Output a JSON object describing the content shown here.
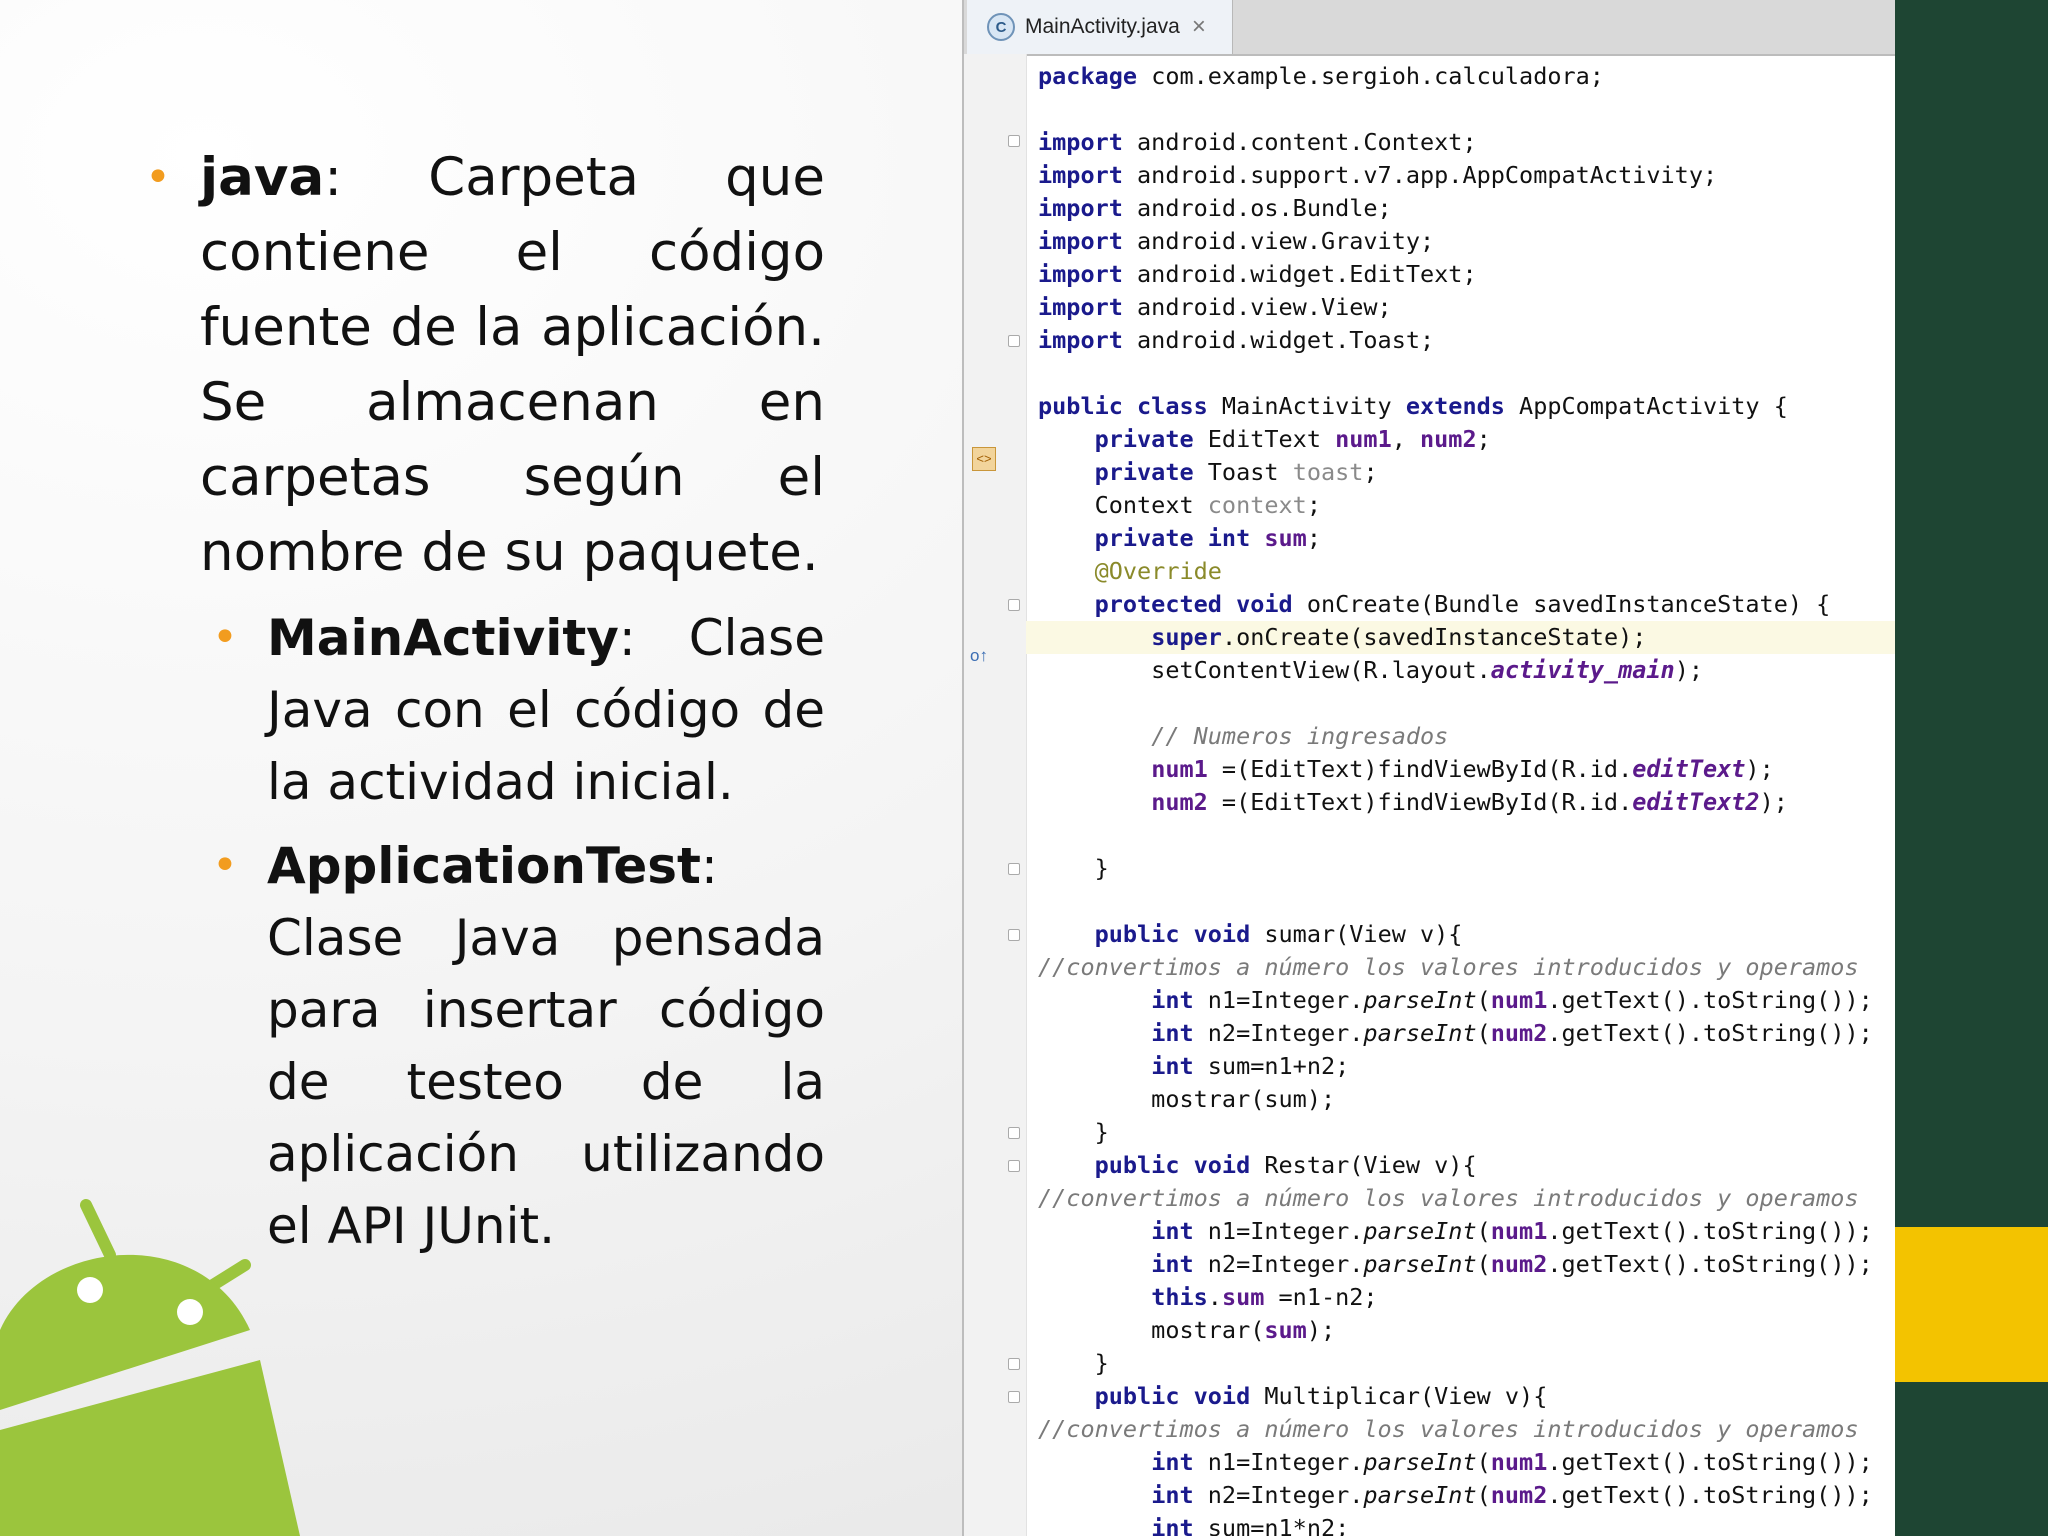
{
  "slide": {
    "bullet_main": {
      "term": "java",
      "text": ": Carpeta que contiene el código fuente de la aplicación. Se almacenan en carpetas según el nombre de su paquete."
    },
    "sub_bullets": [
      {
        "term": "MainActivity",
        "text": ": Clase Java con el código de la actividad inicial."
      },
      {
        "term": "ApplicationTest",
        "text": ": Clase Java pensada para insertar código de testeo de la aplicación utilizando el API JUnit."
      }
    ]
  },
  "editor": {
    "tab_label": "MainActivity.java",
    "tab_icon_letter": "C",
    "close_symbol": "×"
  },
  "colors": {
    "accent_green": "#1e4533",
    "accent_yellow": "#f3c300",
    "bullet_orange": "#f29c1f",
    "android_green": "#9bc53d"
  }
}
